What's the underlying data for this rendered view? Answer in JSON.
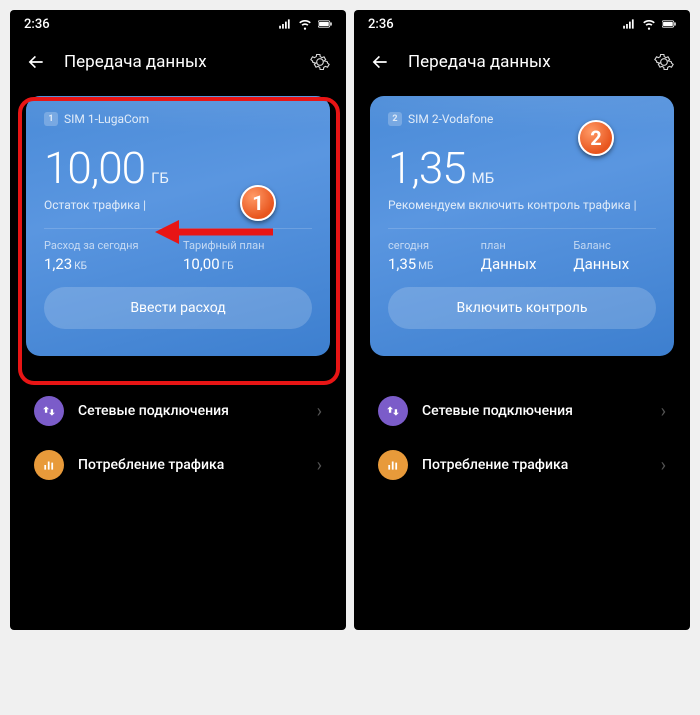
{
  "statusbar": {
    "time": "2:36"
  },
  "header": {
    "title": "Передача данных"
  },
  "screen1": {
    "sim": {
      "badge": "1",
      "name": "SIM 1-LugaCom"
    },
    "main_value": "10,00",
    "main_unit": "ГБ",
    "remaining": "Остаток трафика |",
    "stat1_label": "Расход за сегодня",
    "stat1_value": "1,23",
    "stat1_unit": "КБ",
    "stat2_label": "Тарифный план",
    "stat2_value": "10,00",
    "stat2_unit": "ГБ",
    "button": "Ввести расход"
  },
  "screen2": {
    "sim": {
      "badge": "2",
      "name": "SIM 2-Vodafone"
    },
    "main_value": "1,35",
    "main_unit": "МБ",
    "remaining": "Рекомендуем включить контроль трафика |",
    "stat1_label": "сегодня",
    "stat1_value": "1,35",
    "stat1_unit": "МБ",
    "stat2_label": "план",
    "stat2_value": "Данных",
    "stat3_label": "Баланс",
    "stat3_value": "Данных",
    "button": "Включить контроль"
  },
  "list": {
    "item1": "Сетевые подключения",
    "item2": "Потребление трафика"
  },
  "annotations": {
    "badge1": "1",
    "badge2": "2"
  }
}
